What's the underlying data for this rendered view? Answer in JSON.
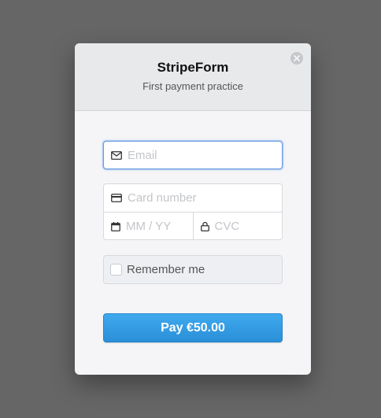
{
  "header": {
    "title": "StripeForm",
    "subtitle": "First payment practice",
    "close_icon": "close-icon"
  },
  "form": {
    "email": {
      "placeholder": "Email",
      "value": "",
      "icon": "envelope-icon"
    },
    "card_number": {
      "placeholder": "Card number",
      "value": "",
      "icon": "credit-card-icon"
    },
    "expiry": {
      "placeholder": "MM / YY",
      "value": "",
      "icon": "calendar-icon"
    },
    "cvc": {
      "placeholder": "CVC",
      "value": "",
      "icon": "lock-icon"
    },
    "remember": {
      "label": "Remember me",
      "checked": false
    },
    "pay_label": "Pay €50.00"
  },
  "colors": {
    "overlay": "#666666",
    "modal_bg": "#f5f5f7",
    "header_bg": "#e8e9eb",
    "button_blue": "#3fa9ee",
    "focus_border": "#6e9ee0"
  }
}
